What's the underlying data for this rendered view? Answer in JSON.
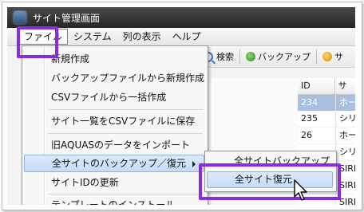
{
  "window": {
    "title": "サイト管理画面"
  },
  "menubar": {
    "items": [
      "ファイル",
      "システム",
      "列の表示",
      "ヘルプ"
    ]
  },
  "toolbar": {
    "search_label": "検索",
    "backup_label": "バックアップ",
    "partial_label": "サ"
  },
  "grid": {
    "headers": [
      "ID",
      "サイ"
    ],
    "rows": [
      {
        "id": "234",
        "name": "ホー",
        "selected": true
      },
      {
        "id": "235",
        "name": "シリ"
      },
      {
        "id": "26",
        "name": "ホー"
      },
      {
        "id": "",
        "name": "シリ"
      },
      {
        "id": "",
        "name": "SIRI"
      },
      {
        "id": "",
        "name": "SIRI"
      },
      {
        "id": "",
        "name": "SIRI"
      }
    ]
  },
  "file_menu": {
    "items": [
      "新規作成",
      "バックアップファイルから新規作成",
      "CSVファイルから一括作成",
      "サイト一覧をCSVファイルに保存",
      "旧AQUASのデータをインポート",
      "全サイトのバックアップ／復元",
      "サイトIDの更新",
      "テンプレートのインストール"
    ]
  },
  "submenu": {
    "items": [
      "全サイトバックアップ",
      "全サイト復元"
    ]
  },
  "colors": {
    "highlight_outline": "#8a2be2",
    "menu_hover": "#c5dcf7",
    "selected_row": "#a9bfe0",
    "titlebar": "#2f2f2f"
  }
}
